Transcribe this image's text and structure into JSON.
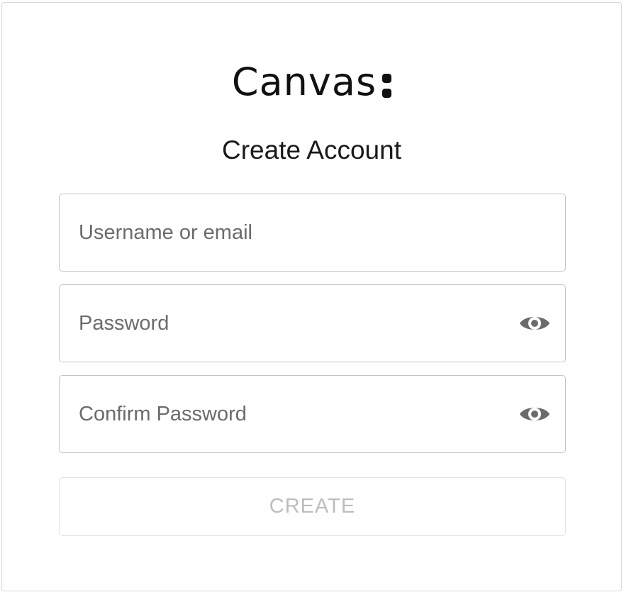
{
  "brand": {
    "name": "Canvas",
    "text_color": "#111111"
  },
  "page": {
    "title": "Create Account"
  },
  "form": {
    "username": {
      "placeholder": "Username or email",
      "value": ""
    },
    "password": {
      "placeholder": "Password",
      "value": "",
      "toggle_icon": "eye-icon"
    },
    "confirm_password": {
      "placeholder": "Confirm Password",
      "value": "",
      "toggle_icon": "eye-icon"
    },
    "submit": {
      "label": "CREATE",
      "state": "disabled"
    }
  },
  "colors": {
    "field_border": "#c4c4c4",
    "placeholder": "#6b6b6b",
    "icon": "#6b6b6b",
    "disabled_text": "#bdbdbd",
    "disabled_border": "#e3e3e3"
  }
}
